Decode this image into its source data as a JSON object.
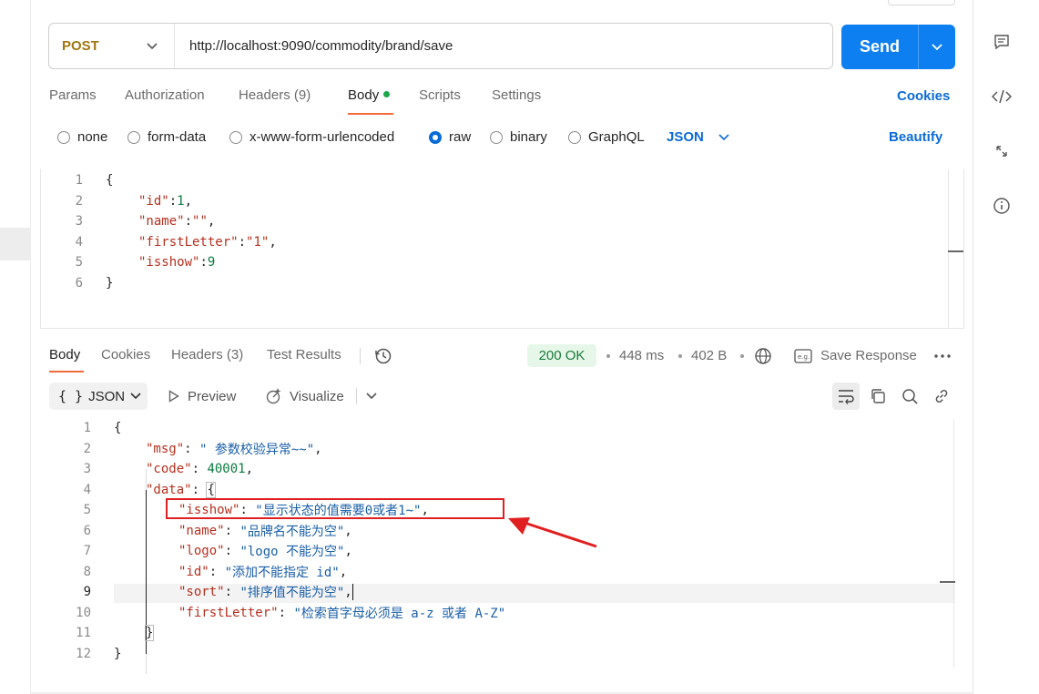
{
  "request": {
    "method": "POST",
    "url": "http://localhost:9090/commodity/brand/save",
    "send_label": "Send"
  },
  "request_tabs": [
    {
      "label": "Params"
    },
    {
      "label": "Authorization"
    },
    {
      "label": "Headers (9)"
    },
    {
      "label": "Body"
    },
    {
      "label": "Scripts"
    },
    {
      "label": "Settings"
    }
  ],
  "cookies_label": "Cookies",
  "body_types": [
    "none",
    "form-data",
    "x-www-form-urlencoded",
    "raw",
    "binary",
    "GraphQL"
  ],
  "body_format": "JSON",
  "beautify_label": "Beautify",
  "request_body_lines": [
    {
      "n": "1",
      "text": "{"
    },
    {
      "n": "2",
      "key": "\"id\"",
      "sep": ":",
      "val": "1",
      "end": ","
    },
    {
      "n": "3",
      "key": "\"name\"",
      "sep": ":",
      "val": "\"\"",
      "end": ","
    },
    {
      "n": "4",
      "key": "\"firstLetter\"",
      "sep": ":",
      "val": "\"1\"",
      "end": ","
    },
    {
      "n": "5",
      "key": "\"isshow\"",
      "sep": ":",
      "val": "9",
      "end": ""
    },
    {
      "n": "6",
      "text": "}"
    }
  ],
  "response_tabs": [
    {
      "label": "Body"
    },
    {
      "label": "Cookies"
    },
    {
      "label": "Headers (3)"
    },
    {
      "label": "Test Results"
    }
  ],
  "response_status": "200 OK",
  "response_time": "448 ms",
  "response_size": "402 B",
  "save_response_label": "Save Response",
  "response_view": {
    "format_label": "JSON",
    "preview_label": "Preview",
    "visualize_label": "Visualize"
  },
  "response_body_lines": [
    {
      "n": "1",
      "text": "{"
    },
    {
      "n": "2",
      "key": "\"msg\"",
      "val": "\" 参数校验异常~~\"",
      "end": ","
    },
    {
      "n": "3",
      "key": "\"code\"",
      "val": "40001",
      "end": ","
    },
    {
      "n": "4",
      "key": "\"data\"",
      "val": "{",
      "end": ""
    },
    {
      "n": "5",
      "key": "\"isshow\"",
      "val": "\"显示状态的值需要0或者1~\"",
      "end": ","
    },
    {
      "n": "6",
      "key": "\"name\"",
      "val": "\"品牌名不能为空\"",
      "end": ","
    },
    {
      "n": "7",
      "key": "\"logo\"",
      "val": "\"logo 不能为空\"",
      "end": ","
    },
    {
      "n": "8",
      "key": "\"id\"",
      "val": "\"添加不能指定 id\"",
      "end": ","
    },
    {
      "n": "9",
      "key": "\"sort\"",
      "val": "\"排序值不能为空\"",
      "end": ","
    },
    {
      "n": "10",
      "key": "\"firstLetter\"",
      "val": "\"检索首字母必须是 a-z 或者 A-Z\"",
      "end": ""
    },
    {
      "n": "11",
      "text": "}"
    },
    {
      "n": "12",
      "text": "}"
    }
  ],
  "colors": {
    "accent": "#0d7ff0",
    "tab_underline": "#f26b3a",
    "annotation": "#e02020",
    "status_ok": "#1a7a3a"
  }
}
